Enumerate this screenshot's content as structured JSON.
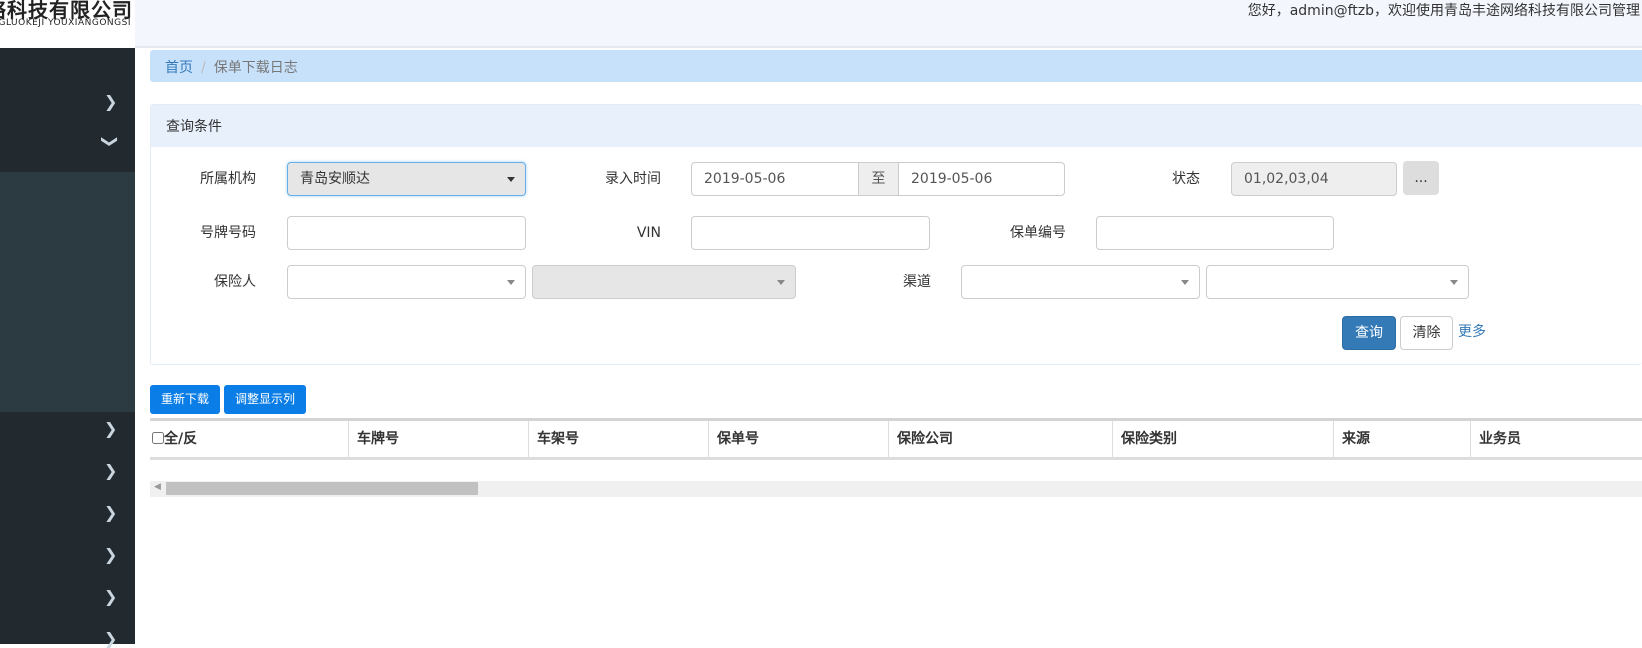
{
  "header": {
    "logo_text": "络科技有限公司",
    "logo_subtext": "GLUOKEJI YOUXIANGONGSI",
    "welcome": "您好，admin@ftzb，欢迎使用青岛丰途网络科技有限公司管理"
  },
  "breadcrumb": {
    "home": "首页",
    "current": "保单下载日志"
  },
  "query": {
    "title": "查询条件",
    "org_label": "所属机构",
    "org_value": "青岛安顺达",
    "time_label": "录入时间",
    "date_from": "2019-05-06",
    "date_sep": "至",
    "date_to": "2019-05-06",
    "status_label": "状态",
    "status_value": "01,02,03,04",
    "status_btn": "...",
    "plate_label": "号牌号码",
    "plate_value": "",
    "vin_label": "VIN",
    "vin_value": "",
    "policy_label": "保单编号",
    "policy_value": "",
    "insurer_label": "保险人",
    "channel_label": "渠道",
    "search_btn": "查询",
    "clear_btn": "清除",
    "more_link": "更多"
  },
  "actions": {
    "redownload": "重新下载",
    "adjust_columns": "调整显示列"
  },
  "table": {
    "columns": [
      "全/反",
      "车牌号",
      "车架号",
      "保单号",
      "保险公司",
      "保险类别",
      "来源",
      "业务员"
    ]
  },
  "colors": {
    "sidebar": "#232a2f",
    "primary": "#337ab7",
    "action": "#0a7de6",
    "breadcrumb_bg": "#c8e1fb"
  }
}
